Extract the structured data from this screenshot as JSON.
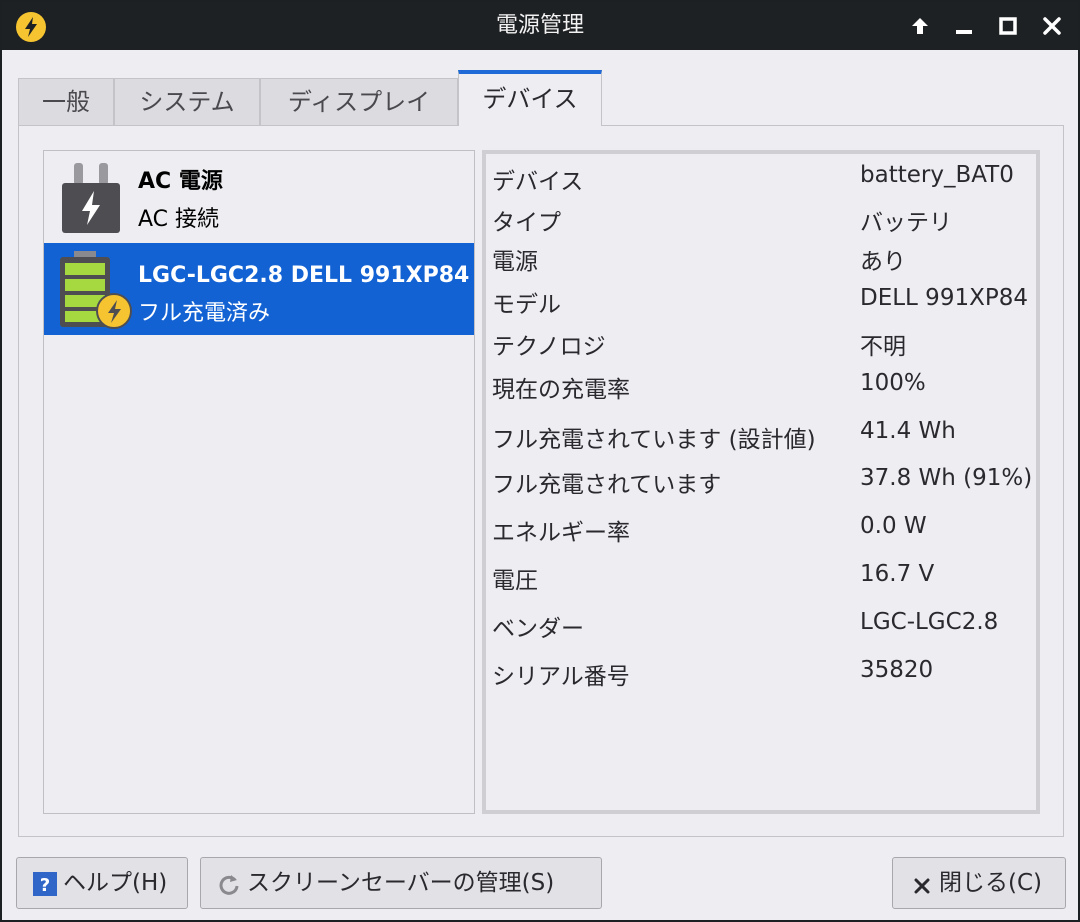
{
  "window": {
    "title": "電源管理",
    "accent_color": "#1262d4"
  },
  "tabs": [
    {
      "label": "一般"
    },
    {
      "label": "システム"
    },
    {
      "label": "ディスプレイ"
    },
    {
      "label": "デバイス",
      "active": true
    }
  ],
  "devices": [
    {
      "title": "AC 電源",
      "subtitle": "AC 接続",
      "icon": "power-plug-icon"
    },
    {
      "title": "LGC-LGC2.8 DELL 991XP84",
      "subtitle": "フル充電済み",
      "icon": "battery-charging-icon",
      "selected": true
    }
  ],
  "details": [
    {
      "label": "デバイス",
      "value": "battery_BAT0"
    },
    {
      "label": "タイプ",
      "value": "バッテリ"
    },
    {
      "label": "電源",
      "value": "あり"
    },
    {
      "label": "モデル",
      "value": "DELL 991XP84"
    },
    {
      "label": "テクノロジ",
      "value": "不明"
    },
    {
      "label": "現在の充電率",
      "value": "100%"
    },
    {
      "label": "フル充電されています (設計値)",
      "value": "41.4 Wh"
    },
    {
      "label": "フル充電されています",
      "value": "37.8 Wh (91%)"
    },
    {
      "label": "エネルギー率",
      "value": "0.0 W"
    },
    {
      "label": "電圧",
      "value": "16.7 V"
    },
    {
      "label": "ベンダー",
      "value": "LGC-LGC2.8"
    },
    {
      "label": "シリアル番号",
      "value": "35820"
    }
  ],
  "buttons": {
    "help": "ヘルプ(H)",
    "screensaver": "スクリーンセーバーの管理(S)",
    "close": "閉じる(C)"
  }
}
